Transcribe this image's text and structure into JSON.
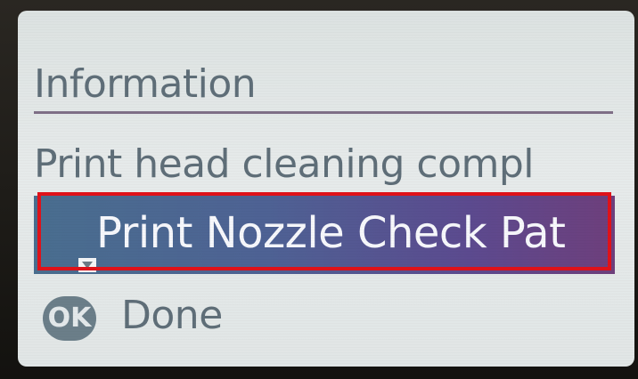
{
  "screen": {
    "title": "Information",
    "message": "Print head cleaning compl",
    "highlighted_option": "Print Nozzle Check Pat",
    "ok_button": "OK",
    "ok_action": "Done"
  },
  "icons": {
    "dropdown": "dropdown-arrow-icon",
    "ok": "ok-button-icon"
  },
  "colors": {
    "lcd_background": "#e2e7e7",
    "lcd_text": "#5f6e78",
    "divider": "#7f6f87",
    "highlight_start": "#496e8f",
    "highlight_end": "#6e3f7c",
    "highlight_text": "#f6f7fb",
    "callout_frame": "#e0121a"
  }
}
